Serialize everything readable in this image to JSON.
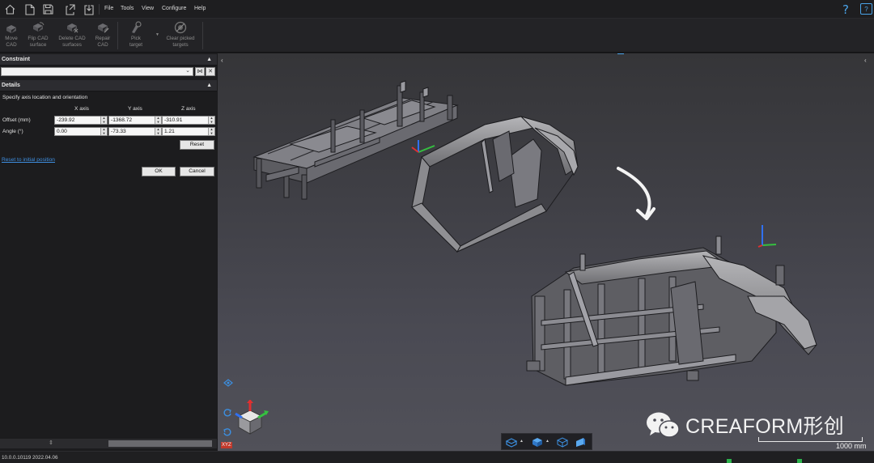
{
  "menu": {
    "items": [
      "File",
      "Tools",
      "View",
      "Configure",
      "Help"
    ],
    "quick_access_icons": [
      "home-icon",
      "new-file-icon",
      "save-icon",
      "export-icon",
      "import-icon"
    ]
  },
  "ribbon": {
    "buttons": [
      {
        "line1": "Move",
        "line2": "CAD",
        "icon": "move-cad-icon"
      },
      {
        "line1": "Flip CAD",
        "line2": "surface",
        "icon": "flip-cad-icon"
      },
      {
        "line1": "Delete CAD",
        "line2": "surfaces",
        "icon": "delete-cad-icon"
      },
      {
        "line1": "Repair",
        "line2": "CAD",
        "icon": "repair-cad-icon"
      },
      {
        "line1": "Pick",
        "line2": "target",
        "icon": "pick-target-icon"
      },
      {
        "line1": "Clear picked",
        "line2": "targets",
        "icon": "clear-targets-icon"
      }
    ]
  },
  "panel": {
    "constraint_title": "Constraint",
    "constraint_value": "",
    "details_title": "Details",
    "details_text": "Specify axis location and orientation",
    "columns": [
      "X axis",
      "Y axis",
      "Z axis"
    ],
    "rows": [
      {
        "label": "Offset (mm)",
        "values": [
          "-239.92",
          "-1368.72",
          "-310.91"
        ]
      },
      {
        "label": "Angle (°)",
        "values": [
          "0.00",
          "-73.33",
          "1.21"
        ]
      }
    ],
    "reset_label": "Reset",
    "reset_link": "Reset to initial position",
    "ok_label": "OK",
    "cancel_label": "Cancel"
  },
  "viewport": {
    "watermark": "CREAFORM形创",
    "scale_label": "1000 mm",
    "view_cube_label": "XYZ",
    "accent_blue": "#3c8fe0",
    "axis_colors": {
      "x": "#e03030",
      "y": "#35c040",
      "z": "#3070f0"
    }
  },
  "status": {
    "version": "10.0.0.10119 2022.04.06"
  }
}
